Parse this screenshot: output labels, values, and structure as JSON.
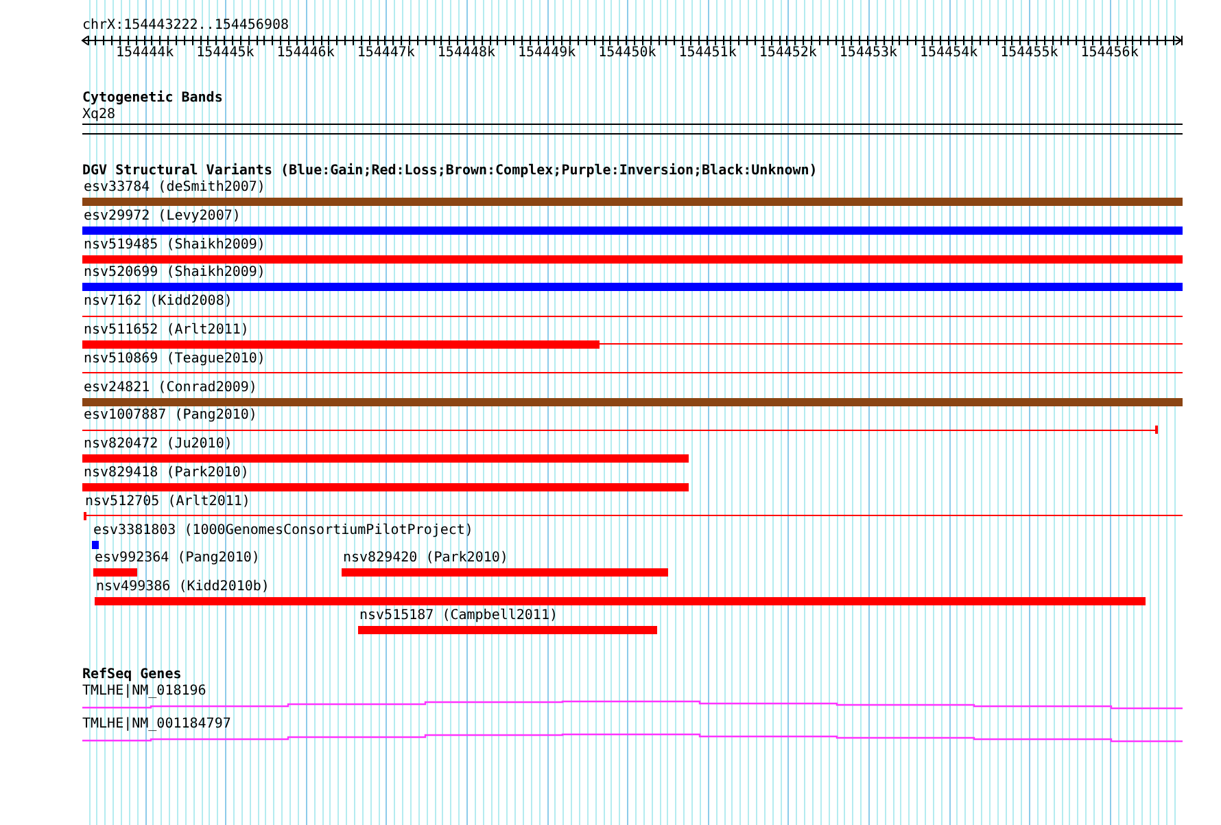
{
  "ruler": {
    "title": "chrX:154443222..154456908",
    "ticks": [
      "154444k",
      "154445k",
      "154446k",
      "154447k",
      "154448k",
      "154449k",
      "154450k",
      "154451k",
      "154452k",
      "154453k",
      "154454k",
      "154455k",
      "154456k"
    ]
  },
  "cytogenetic_bands": {
    "title": "Cytogenetic Bands",
    "band": "Xq28"
  },
  "dgv": {
    "title": "DGV Structural Variants (Blue:Gain;Red:Loss;Brown:Complex;Purple:Inversion;Black:Unknown)",
    "rows": [
      {
        "features": [
          {
            "label": "esv33784 (deSmith2007)",
            "color": "#8b4513"
          }
        ]
      },
      {
        "features": [
          {
            "label": "esv29972 (Levy2007)",
            "color": "#0000ff"
          }
        ]
      },
      {
        "features": [
          {
            "label": "nsv519485 (Shaikh2009)",
            "color": "#ff0000"
          }
        ]
      },
      {
        "features": [
          {
            "label": "nsv520699 (Shaikh2009)",
            "color": "#0000ff"
          }
        ]
      },
      {
        "features": [
          {
            "label": "nsv7162 (Kidd2008)",
            "color": "#ff0000"
          }
        ]
      },
      {
        "features": [
          {
            "label": "nsv511652 (Arlt2011)",
            "color": "#ff0000"
          }
        ]
      },
      {
        "features": [
          {
            "label": "nsv510869 (Teague2010)",
            "color": "#ff0000"
          }
        ]
      },
      {
        "features": [
          {
            "label": "esv24821 (Conrad2009)",
            "color": "#8b4513"
          }
        ]
      },
      {
        "features": [
          {
            "label": "esv1007887 (Pang2010)",
            "color": "#ff0000"
          }
        ]
      },
      {
        "features": [
          {
            "label": "nsv820472 (Ju2010)",
            "color": "#ff0000"
          }
        ]
      },
      {
        "features": [
          {
            "label": "nsv829418 (Park2010)",
            "color": "#ff0000"
          }
        ]
      },
      {
        "features": [
          {
            "label": "nsv512705 (Arlt2011)",
            "color": "#ff0000"
          }
        ]
      },
      {
        "features": [
          {
            "label": "esv3381803 (1000GenomesConsortiumPilotProject)",
            "color": "#0000ff"
          }
        ]
      },
      {
        "features": [
          {
            "label": "esv992364 (Pang2010)",
            "color": "#ff0000"
          },
          {
            "label": "nsv829420 (Park2010)",
            "color": "#ff0000"
          }
        ]
      },
      {
        "features": [
          {
            "label": "nsv499386 (Kidd2010b)",
            "color": "#ff0000"
          }
        ]
      },
      {
        "features": [
          {
            "label": "nsv515187 (Campbell2011)",
            "color": "#ff0000"
          }
        ]
      }
    ]
  },
  "refseq_genes": {
    "title": "RefSeq Genes",
    "genes": [
      {
        "label": "TMLHE|NM_018196"
      },
      {
        "label": "TMLHE|NM_001184797"
      }
    ]
  }
}
